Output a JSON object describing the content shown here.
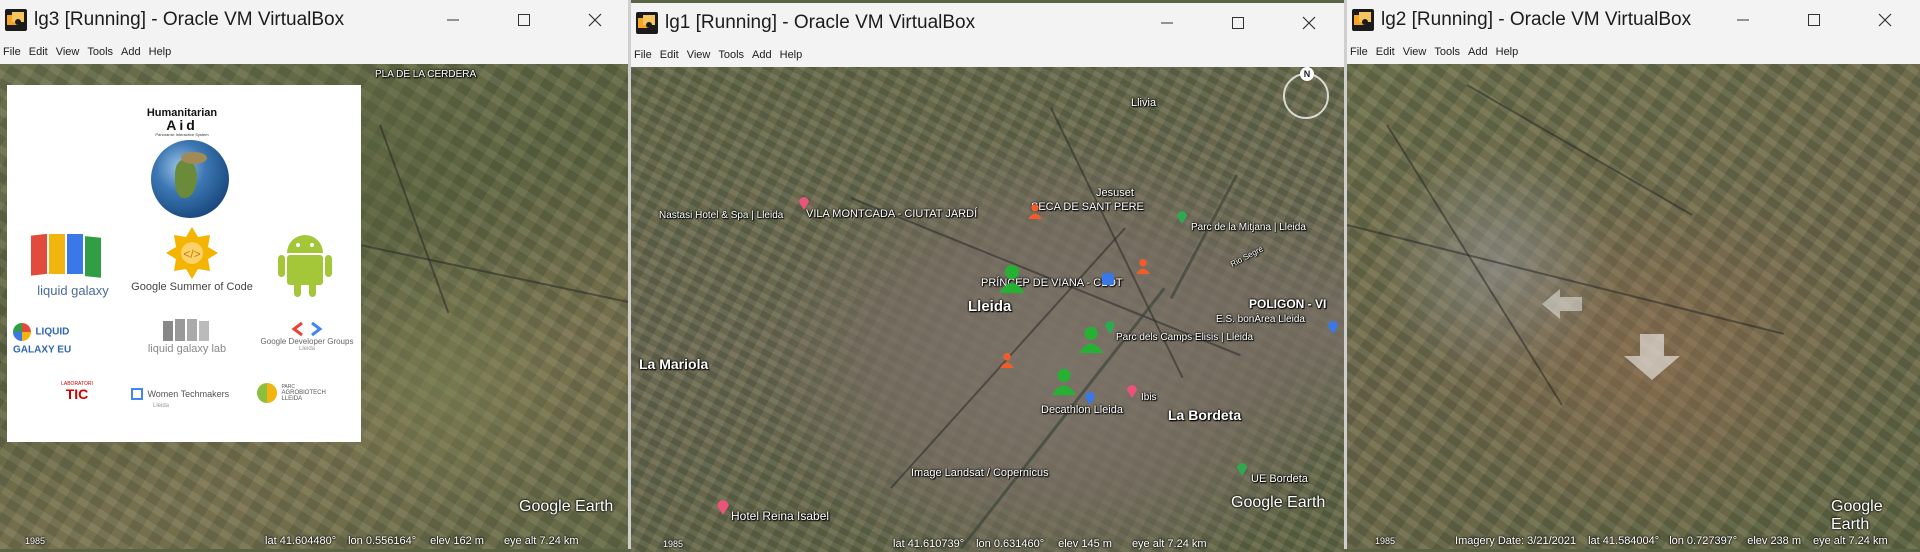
{
  "windows": {
    "lg3": {
      "title": "lg3 [Running] - Oracle VM VirtualBox",
      "menu": [
        "File",
        "Edit",
        "View",
        "Tools",
        "Add",
        "Help"
      ],
      "map_labels": {
        "plaça": "PLA DE LA CERDERA"
      },
      "logo_card": {
        "hum_title": "Humanitarian",
        "hum_aid": "Aid",
        "hum_sub": "Panoramic Interactive System",
        "lg_text": "liquid galaxy",
        "gsoc_text": "Google Summer of Code",
        "lgeu_text": "LIQUID GALAXY EU",
        "lglab_text": "liquid galaxy lab",
        "gdg_text": "Google Developer Groups",
        "gdg_sub": "Lleida",
        "lab_top": "LABORATORI",
        "lab_tic": "TIC",
        "wt_text": "Women Techmakers",
        "wt_sub": "Lleida",
        "parc_top": "PARC",
        "parc_mid": "AGROBIOTECH",
        "parc_bot": "LLEIDA"
      },
      "google_earth": "Google Earth",
      "status": {
        "year": "1985",
        "lat": "lat  41.604480°",
        "lon": "lon   0.556164°",
        "elev": "elev  162 m",
        "eye": "eye alt  7.24 km"
      }
    },
    "lg1": {
      "title": "lg1 [Running] - Oracle VM VirtualBox",
      "menu": [
        "File",
        "Edit",
        "View",
        "Tools",
        "Add",
        "Help"
      ],
      "map_labels": {
        "llivia": "Llivia",
        "jesuset": "Jesuset",
        "nastasi": "Nastasi Hotel & Spa | Lleida",
        "vila": "VILA MONTCADA - CIUTAT JARDÍ",
        "seca": "SECA DE SANT PERE",
        "mitjana": "Parc de la Mitjana | Lleida",
        "pinyana": "Rio Segre",
        "viana": "PRÍNCEP DE VIANA - CLOT",
        "lleida": "Lleida",
        "poligon": "POLIGON - VI",
        "bonarea": "E.S. bonÀrea Lleida",
        "camps": "Parc dels Camps Elisis | Lleida",
        "mariola": "La Mariola",
        "ibis": "Ibis",
        "decathlon": "Decathlon Lleida",
        "bordeta": "La Bordeta",
        "landsat": "Image Landsat / Copernicus",
        "uebordeta": "UE Bordeta",
        "reina": "Hotel Reina Isabel"
      },
      "compass_n": "N",
      "google_earth": "Google Earth",
      "status": {
        "year": "1985",
        "lat": "lat  41.610739°",
        "lon": "lon   0.631460°",
        "elev": "elev  145 m",
        "eye": "eye alt  7.24 km"
      }
    },
    "lg2": {
      "title": "lg2 [Running] - Oracle VM VirtualBox",
      "menu": [
        "File",
        "Edit",
        "View",
        "Tools",
        "Add",
        "Help"
      ],
      "google_earth": "Google Earth",
      "status": {
        "year": "1985",
        "date": "Imagery Date: 3/21/2021",
        "lat": "lat  41.584004°",
        "lon": "lon   0.727397°",
        "elev": "elev  238 m",
        "eye": "eye alt  7.24 km"
      }
    }
  },
  "colors": {
    "titlebar": "#f3f3f3",
    "marker_green": "#25b233",
    "marker_orange": "#f25c2a"
  }
}
